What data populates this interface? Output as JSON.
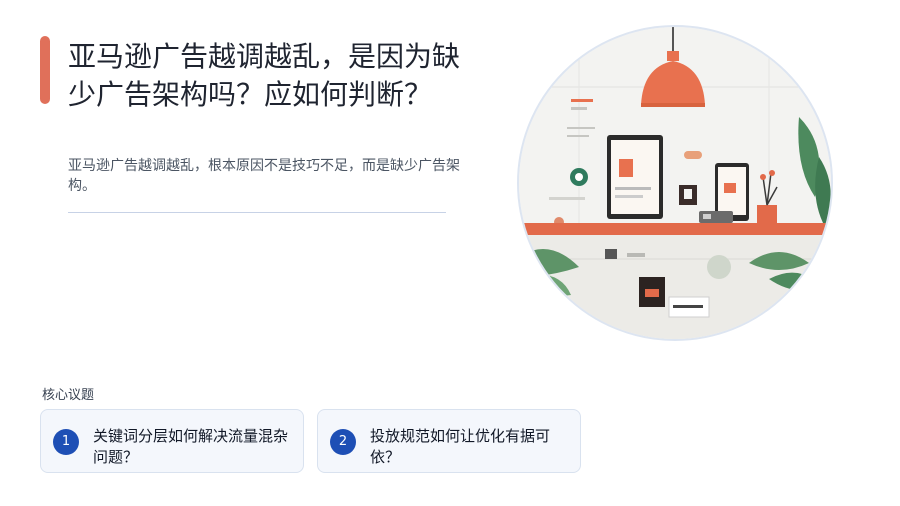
{
  "header": {
    "title": "亚马逊广告越调越乱，是因为缺少广告架构吗？应如何判断？",
    "subtitle": "亚马逊广告越调越乱，根本原因不是技巧不足，而是缺少广告架构。"
  },
  "hero": {
    "alt": "",
    "colors": {
      "accent": "#e8714f",
      "shelf": "#e26a4a",
      "wall": "#f3f3f1",
      "plant": "#3f7a52"
    }
  },
  "core_issues": {
    "label": "核心议题",
    "items": [
      {
        "number": "1",
        "text": "关键词分层如何解决流量混杂问题？"
      },
      {
        "number": "2",
        "text": "投放规范如何让优化有据可依？"
      }
    ]
  },
  "colors": {
    "accent_bar": "#e0705a",
    "number_badge": "#1e4fb5",
    "card_bg": "#f4f7fc"
  }
}
